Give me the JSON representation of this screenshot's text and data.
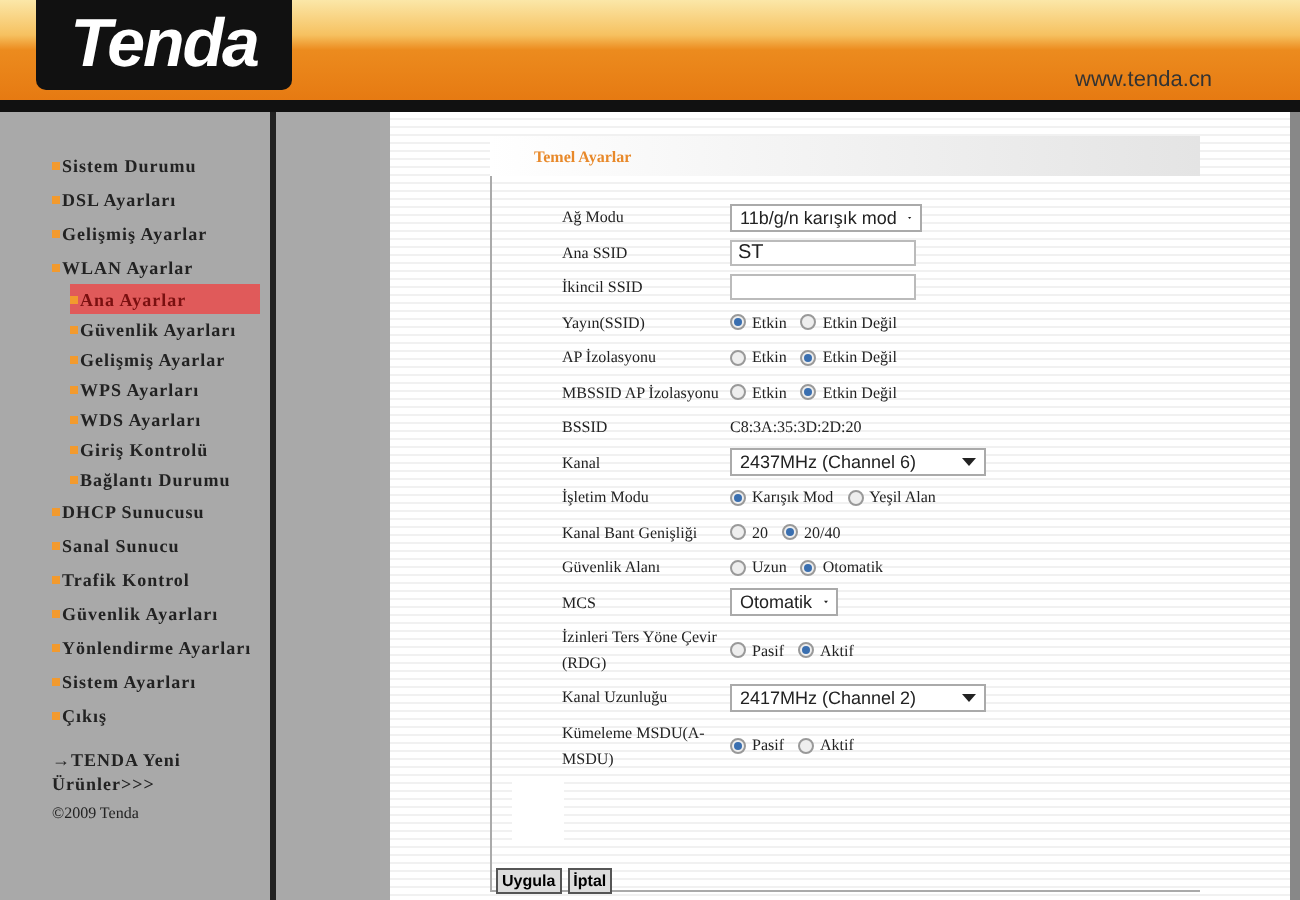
{
  "header": {
    "logo": "Tenda",
    "url": "www.tenda.cn"
  },
  "sidebar": {
    "items": [
      {
        "label": "Sistem Durumu",
        "selected": false
      },
      {
        "label": "DSL Ayarları",
        "selected": false
      },
      {
        "label": "Gelişmiş Ayarlar",
        "selected": false
      },
      {
        "label": "WLAN Ayarlar",
        "selected": false,
        "expanded": true,
        "children": [
          {
            "label": "Ana Ayarlar",
            "selected": true
          },
          {
            "label": "Güvenlik Ayarları",
            "selected": false
          },
          {
            "label": "Gelişmiş Ayarlar",
            "selected": false
          },
          {
            "label": "WPS Ayarları",
            "selected": false
          },
          {
            "label": "WDS Ayarları",
            "selected": false
          },
          {
            "label": "Giriş Kontrolü",
            "selected": false
          },
          {
            "label": "Bağlantı Durumu",
            "selected": false
          }
        ]
      },
      {
        "label": "DHCP Sunucusu",
        "selected": false
      },
      {
        "label": "Sanal Sunucu",
        "selected": false
      },
      {
        "label": "Trafik Kontrol",
        "selected": false
      },
      {
        "label": "Güvenlik Ayarları",
        "selected": false
      },
      {
        "label": "Yönlendirme Ayarları",
        "selected": false
      },
      {
        "label": "Sistem Ayarları",
        "selected": false
      },
      {
        "label": "Çıkış",
        "selected": false
      }
    ],
    "promo_link": "→TENDA Yeni Ürünler>>>",
    "copyright": "©2009 Tenda"
  },
  "panel": {
    "title": "Temel Ayarlar",
    "rows": [
      {
        "label": "Ağ Modu",
        "kind": "select",
        "value": "11b/g/n karışık mod"
      },
      {
        "label": "Ana SSID",
        "kind": "text",
        "value": "ST"
      },
      {
        "label": "İkincil SSID",
        "kind": "text",
        "value": ""
      },
      {
        "label": "Yayın(SSID)",
        "kind": "radio",
        "options": [
          {
            "label": "Etkin",
            "selected": true
          },
          {
            "label": "Etkin Değil",
            "selected": false
          }
        ]
      },
      {
        "label": "AP İzolasyonu",
        "kind": "radio",
        "options": [
          {
            "label": "Etkin",
            "selected": false
          },
          {
            "label": "Etkin Değil",
            "selected": true
          }
        ]
      },
      {
        "label": "MBSSID AP İzolasyonu",
        "kind": "radio",
        "options": [
          {
            "label": "Etkin",
            "selected": false
          },
          {
            "label": "Etkin Değil",
            "selected": true
          }
        ]
      },
      {
        "label": "BSSID",
        "kind": "static",
        "value": "C8:3A:35:3D:2D:20"
      },
      {
        "label": "Kanal",
        "kind": "select",
        "value": "2437MHz (Channel 6)"
      },
      {
        "label": "İşletim Modu",
        "kind": "radio",
        "options": [
          {
            "label": "Karışık Mod",
            "selected": true
          },
          {
            "label": "Yeşil Alan",
            "selected": false
          }
        ]
      },
      {
        "label": "Kanal Bant Genişliği",
        "kind": "radio",
        "options": [
          {
            "label": "20",
            "selected": false
          },
          {
            "label": "20/40",
            "selected": true
          }
        ]
      },
      {
        "label": "Güvenlik Alanı",
        "kind": "radio",
        "options": [
          {
            "label": "Uzun",
            "selected": false
          },
          {
            "label": "Otomatik",
            "selected": true
          }
        ]
      },
      {
        "label": "MCS",
        "kind": "select",
        "value": "Otomatik"
      },
      {
        "label": "İzinleri Ters Yöne Çevir (RDG)",
        "kind": "radio",
        "options": [
          {
            "label": "Pasif",
            "selected": false
          },
          {
            "label": "Aktif",
            "selected": true
          }
        ]
      },
      {
        "label": "Kanal Uzunluğu",
        "kind": "select",
        "value": "2417MHz (Channel 2)"
      },
      {
        "label": "Kümeleme MSDU(A-MSDU)",
        "kind": "radio",
        "options": [
          {
            "label": "Pasif",
            "selected": true
          },
          {
            "label": "Aktif",
            "selected": false
          }
        ]
      }
    ],
    "buttons": [
      "Uygula",
      "İptal"
    ]
  }
}
